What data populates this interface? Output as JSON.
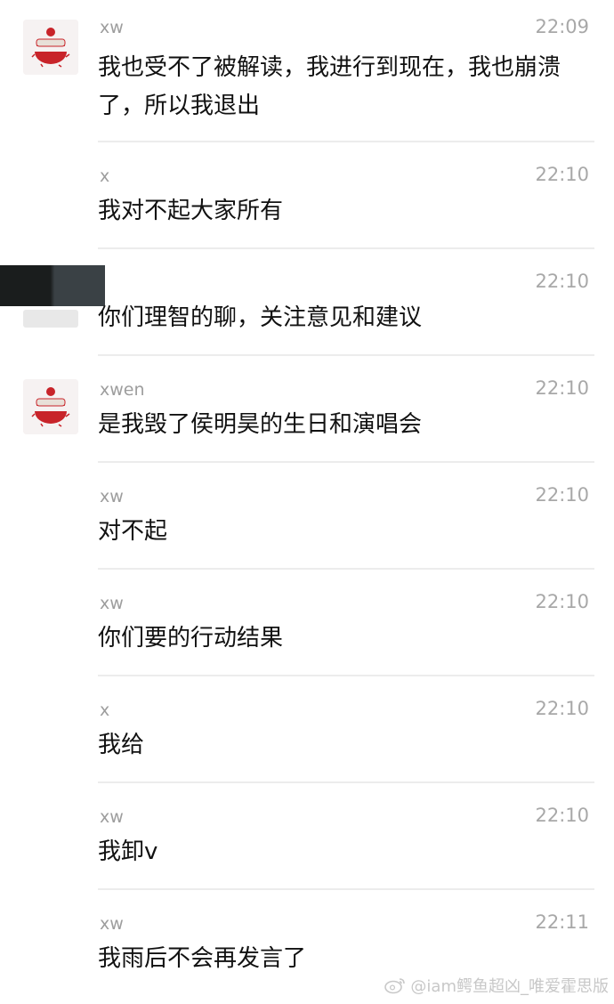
{
  "messages": [
    {
      "sender": "xw",
      "time": "22:09",
      "text": "我也受不了被解读，我进行到现在，我也崩溃了，所以我退出",
      "avatar": "cartoon-avatar"
    },
    {
      "sender": "x",
      "time": "22:10",
      "text": "我对不起大家所有",
      "avatar": ""
    },
    {
      "sender": "",
      "time": "22:10",
      "text": "你们理智的聊，关注意见和建议",
      "avatar": ""
    },
    {
      "sender": "xwen",
      "time": "22:10",
      "text": "是我毁了侯明昊的生日和演唱会",
      "avatar": "cartoon-avatar"
    },
    {
      "sender": "xw",
      "time": "22:10",
      "text": "对不起",
      "avatar": ""
    },
    {
      "sender": "xw",
      "time": "22:10",
      "text": "你们要的行动结果",
      "avatar": ""
    },
    {
      "sender": "x",
      "time": "22:10",
      "text": "我给",
      "avatar": ""
    },
    {
      "sender": "xw",
      "time": "22:10",
      "text": "我卸v",
      "avatar": ""
    },
    {
      "sender": "xw",
      "time": "22:11",
      "text": "我雨后不会再发言了",
      "avatar": ""
    }
  ],
  "watermark": {
    "text": "@iam鳄鱼超凶_唯爱霍思版",
    "icon": "weibo-icon"
  },
  "colors": {
    "background": "#ffffff",
    "text": "#111111",
    "meta": "#a8a8a8",
    "divider": "#ececec",
    "avatar_accent": "#c8242a"
  }
}
